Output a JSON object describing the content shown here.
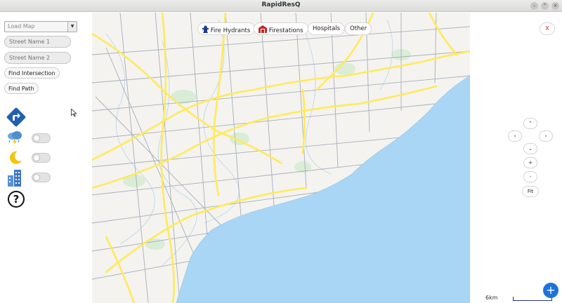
{
  "window": {
    "title": "RapidResQ",
    "controls": {
      "minimize": "–",
      "maximize": "⌃",
      "close": "×"
    }
  },
  "sidebar": {
    "map_select": {
      "value": "Load Map",
      "arrow": "▼"
    },
    "street1": {
      "placeholder": "Street Name 1"
    },
    "street2": {
      "placeholder": "Street Name 2"
    },
    "find_intersection": "Find Intersection",
    "find_path": "Find Path",
    "help": "?",
    "toggles": [
      {
        "icon": "weather-storm-icon",
        "on": false
      },
      {
        "icon": "night-mode-icon",
        "on": false
      },
      {
        "icon": "buildings-icon",
        "on": false
      }
    ]
  },
  "filters": {
    "fire_hydrants": "Fire Hydrants",
    "firestations": "Firestations",
    "hospitals": "Hospitals",
    "other": "Other"
  },
  "right": {
    "close": "X",
    "nav": {
      "up": "⌃",
      "left": "‹",
      "right": "›",
      "down": "⌄"
    },
    "zoom_in": "+",
    "zoom_out": "-",
    "fit": "Fit",
    "scale": "6km",
    "fab": "+"
  },
  "colors": {
    "water": "#a9d6f5",
    "highway": "#ffea5c",
    "road": "#8f98a8",
    "park": "#d3ebd0",
    "accent": "#1e73d8",
    "direction_sign": "#1f5fb4"
  }
}
